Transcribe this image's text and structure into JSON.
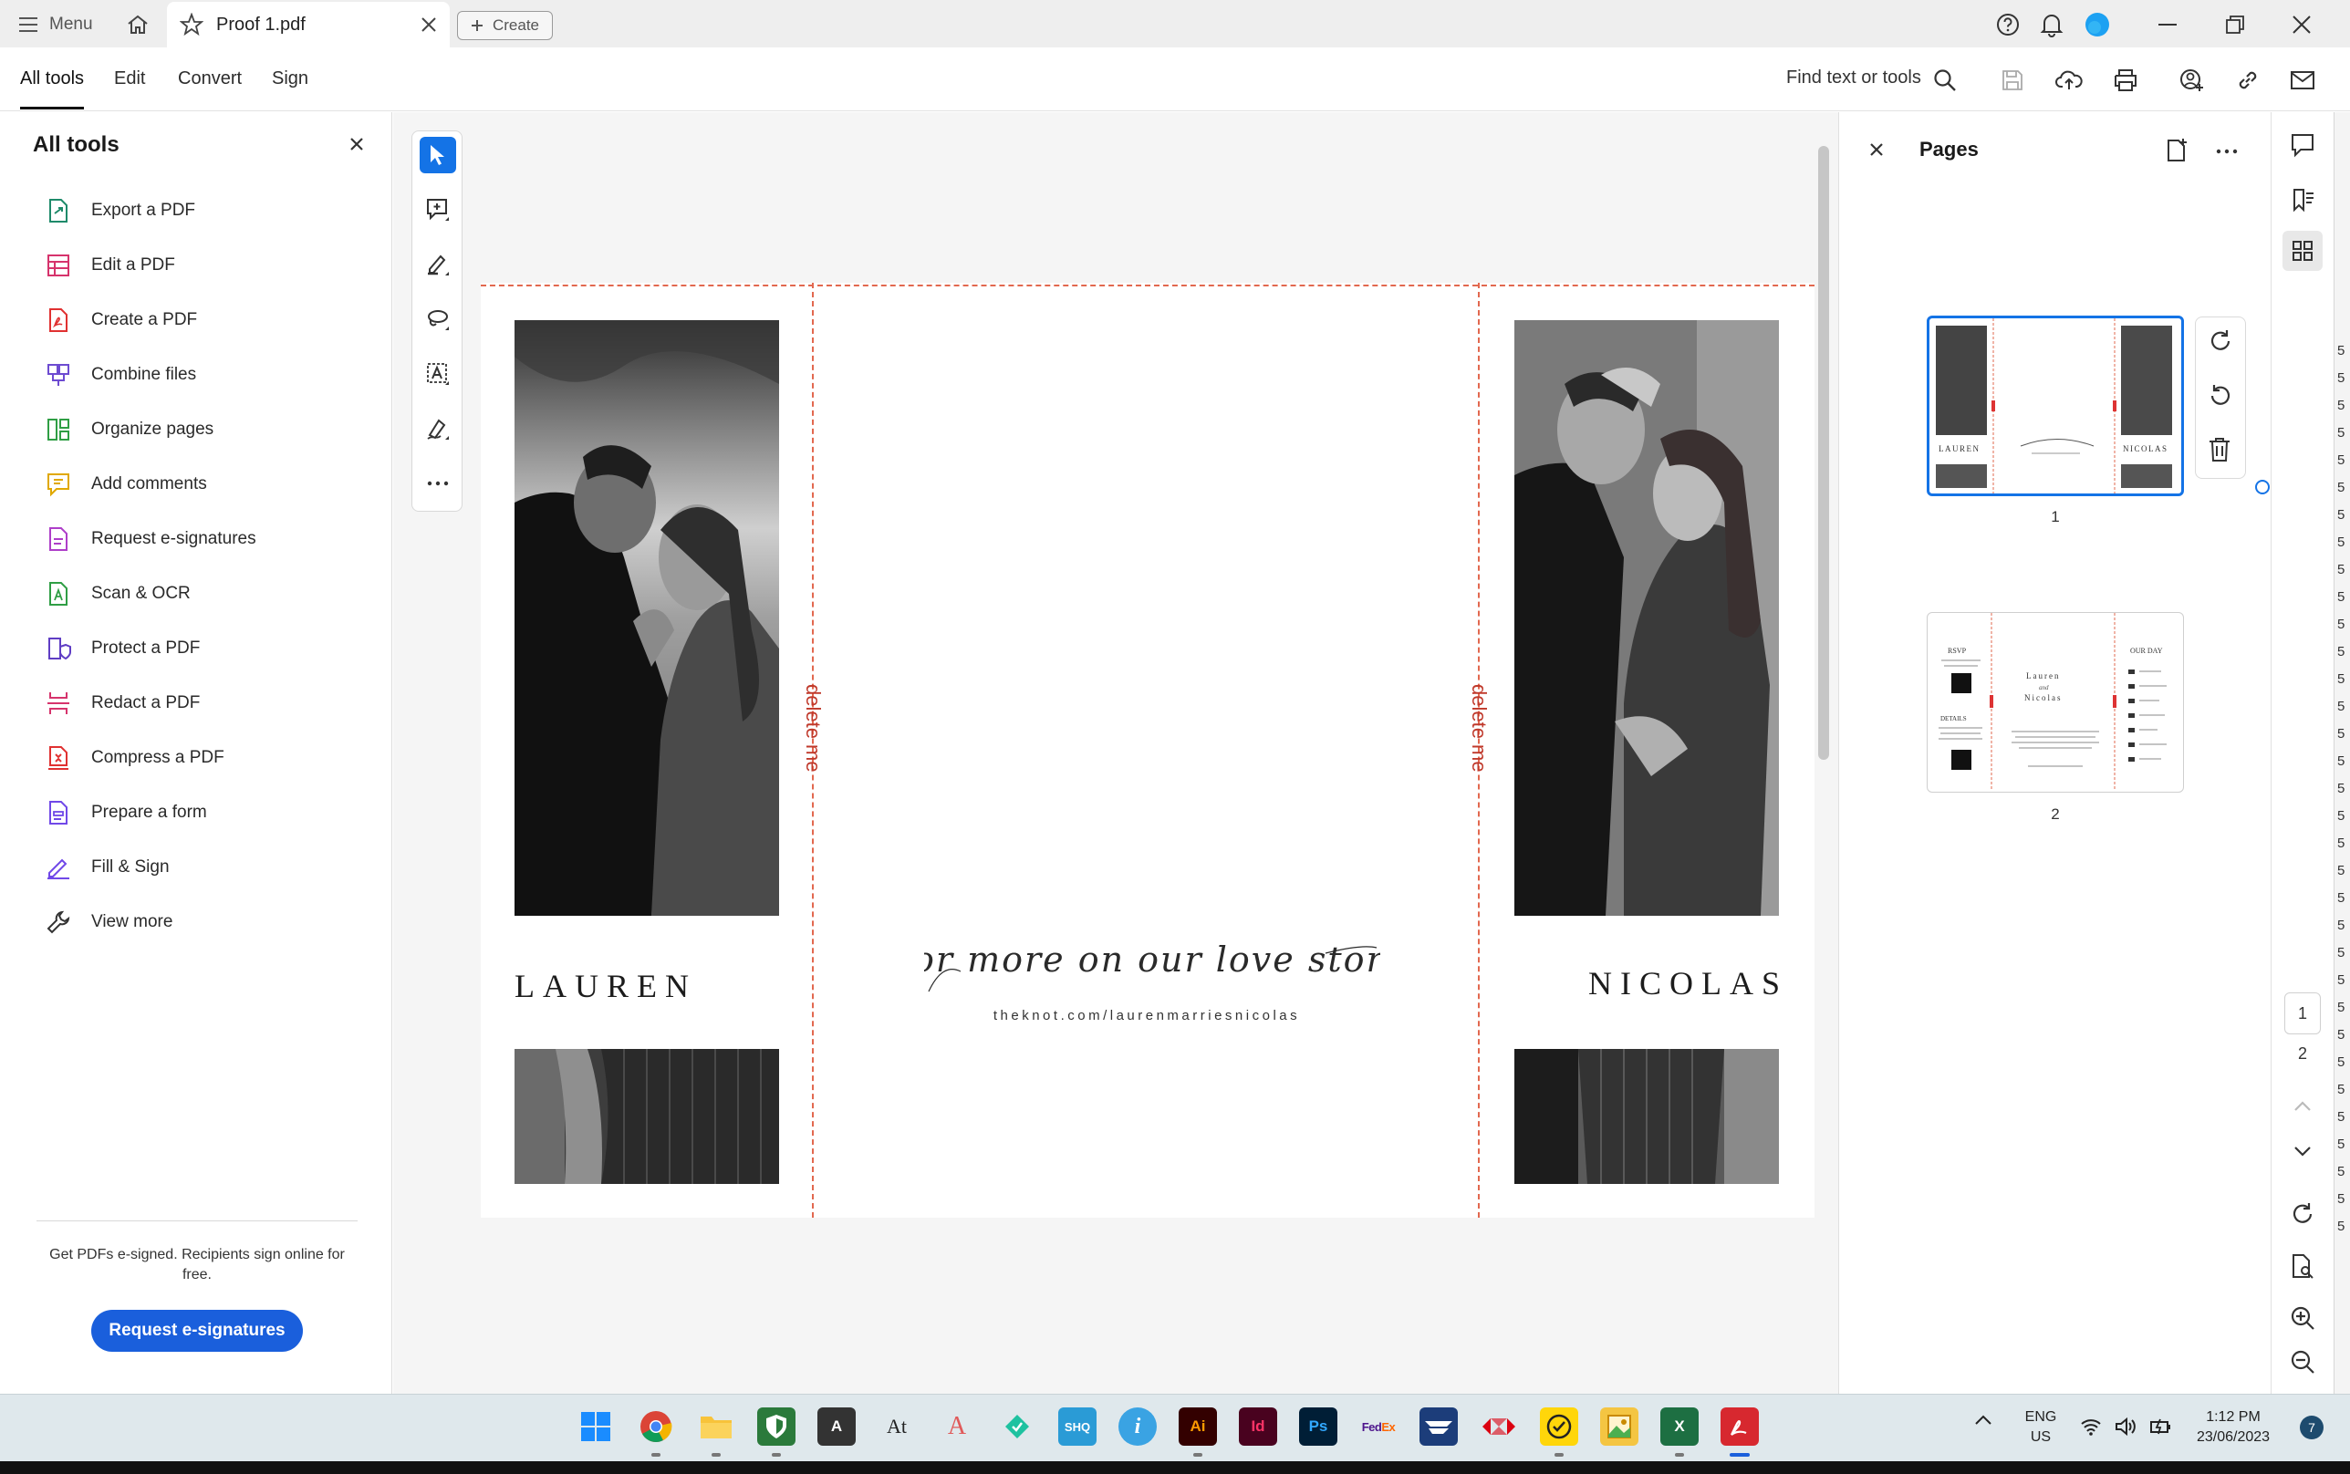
{
  "titlebar": {
    "menu_label": "Menu",
    "tab_title": "Proof 1.pdf",
    "create_label": "Create"
  },
  "menubar": {
    "items": [
      "All tools",
      "Edit",
      "Convert",
      "Sign"
    ],
    "find_label": "Find text or tools"
  },
  "left_panel": {
    "title": "All tools",
    "tools": [
      {
        "label": "Export a PDF",
        "icon": "export-pdf-icon",
        "color": "#1e8a6a"
      },
      {
        "label": "Edit a PDF",
        "icon": "edit-pdf-icon",
        "color": "#d6336c"
      },
      {
        "label": "Create a PDF",
        "icon": "create-pdf-icon",
        "color": "#e03131"
      },
      {
        "label": "Combine files",
        "icon": "combine-files-icon",
        "color": "#6d4bd1"
      },
      {
        "label": "Organize pages",
        "icon": "organize-pages-icon",
        "color": "#2f9e44"
      },
      {
        "label": "Add comments",
        "icon": "add-comments-icon",
        "color": "#e0a800"
      },
      {
        "label": "Request e-signatures",
        "icon": "request-esign-icon",
        "color": "#ae3ec9"
      },
      {
        "label": "Scan & OCR",
        "icon": "scan-ocr-icon",
        "color": "#2f9e44"
      },
      {
        "label": "Protect a PDF",
        "icon": "protect-pdf-icon",
        "color": "#5f3dc4"
      },
      {
        "label": "Redact a PDF",
        "icon": "redact-pdf-icon",
        "color": "#d6336c"
      },
      {
        "label": "Compress a PDF",
        "icon": "compress-pdf-icon",
        "color": "#e03131"
      },
      {
        "label": "Prepare a form",
        "icon": "prepare-form-icon",
        "color": "#7048e8"
      },
      {
        "label": "Fill & Sign",
        "icon": "fill-sign-icon",
        "color": "#7048e8"
      },
      {
        "label": "View more",
        "icon": "wrench-icon",
        "color": "#333333"
      }
    ],
    "promo_text": "Get PDFs e-signed. Recipients sign online for free.",
    "promo_button": "Request e-signatures"
  },
  "document": {
    "left_name": "LAUREN",
    "right_name": "NICOLAS",
    "script_text": "for more on our love story",
    "url": "theknot.com/laurenmarriesnicolas",
    "delete_label": "delete me"
  },
  "pages_panel": {
    "title": "Pages",
    "thumbnails": [
      {
        "number": "1",
        "selected": true
      },
      {
        "number": "2",
        "selected": false
      }
    ]
  },
  "page_nav": {
    "current": "1",
    "total": "2"
  },
  "edge_chars": [
    "5",
    "5",
    "5",
    "5",
    "5",
    "5",
    "5",
    "5",
    "5",
    "5",
    "5",
    "5",
    "5",
    "5",
    "5",
    "5",
    "5",
    "5",
    "5",
    "5",
    "5",
    "5",
    "5",
    "5",
    "5",
    "5",
    "5",
    "5",
    "5",
    "5",
    "5",
    "5",
    "5"
  ],
  "taskbar": {
    "language_top": "ENG",
    "language_bottom": "US",
    "time": "1:12 PM",
    "date": "23/06/2023",
    "notification_count": "7",
    "apps": [
      {
        "name": "windows-start",
        "label": "",
        "bg": "#dfe8ec"
      },
      {
        "name": "chrome",
        "label": "",
        "bg": "#dfe8ec"
      },
      {
        "name": "file-explorer",
        "label": "",
        "bg": "#dfe8ec"
      },
      {
        "name": "app-green-shield",
        "label": "",
        "bg": "#2b7a3b"
      },
      {
        "name": "app-a-dark",
        "label": "A",
        "bg": "#333333"
      },
      {
        "name": "app-at",
        "label": "At",
        "bg": "#dfe8ec"
      },
      {
        "name": "app-font",
        "label": "A",
        "bg": "#dfe8ec"
      },
      {
        "name": "app-teal-tag",
        "label": "",
        "bg": "#1ec2a0"
      },
      {
        "name": "app-shq",
        "label": "SHQ",
        "bg": "#2a9bd6"
      },
      {
        "name": "app-info",
        "label": "i",
        "bg": "#3aa3e3"
      },
      {
        "name": "illustrator",
        "label": "Ai",
        "bg": "#330000"
      },
      {
        "name": "indesign",
        "label": "Id",
        "bg": "#49021f"
      },
      {
        "name": "photoshop",
        "label": "Ps",
        "bg": "#001e36"
      },
      {
        "name": "fedex",
        "label": "FedEx",
        "bg": "#dfe8ec"
      },
      {
        "name": "usps",
        "label": "",
        "bg": "#1c3d7a"
      },
      {
        "name": "hsbc",
        "label": "",
        "bg": "#dfe8ec"
      },
      {
        "name": "app-yellow-check",
        "label": "",
        "bg": "#ffd60a"
      },
      {
        "name": "app-photo",
        "label": "",
        "bg": "#f4c542"
      },
      {
        "name": "excel",
        "label": "X",
        "bg": "#1d6f42"
      },
      {
        "name": "acrobat",
        "label": "",
        "bg": "#d7282f"
      }
    ]
  }
}
